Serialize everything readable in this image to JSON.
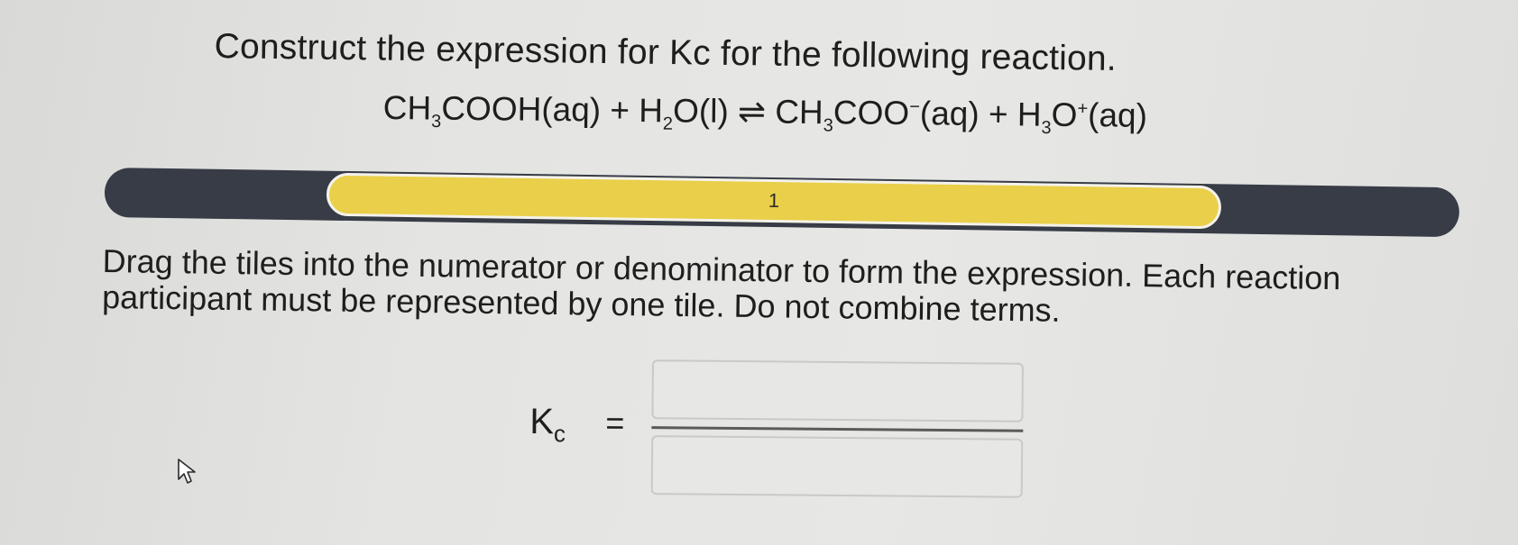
{
  "question": {
    "instruction": "Construct the expression for Kc for the following reaction.",
    "reaction": {
      "r1": "CH",
      "r1_sub": "3",
      "r1_rest": "COOH(aq) + H",
      "r2_sub": "2",
      "r2_rest": "O(l) ⇌ CH",
      "p1_sub": "3",
      "p1_rest": "COO",
      "p1_sup": "−",
      "p1_tail": "(aq) + H",
      "p2_sub": "3",
      "p2_rest": "O",
      "p2_sup": "+",
      "p2_tail": "(aq)"
    }
  },
  "progress": {
    "current_step": "1"
  },
  "drag_instruction": "Drag the tiles into the numerator or denominator to form the expression. Each reaction participant must be represented by one tile. Do not combine terms.",
  "expression": {
    "kc_letter": "K",
    "kc_sub": "c",
    "equals": "=",
    "numerator": "",
    "denominator": ""
  },
  "colors": {
    "track": "#373c46",
    "step_highlight": "#e9cf4a",
    "background": "#e4e4e2"
  },
  "icons": {
    "cursor": "pointer-arrow-icon"
  }
}
